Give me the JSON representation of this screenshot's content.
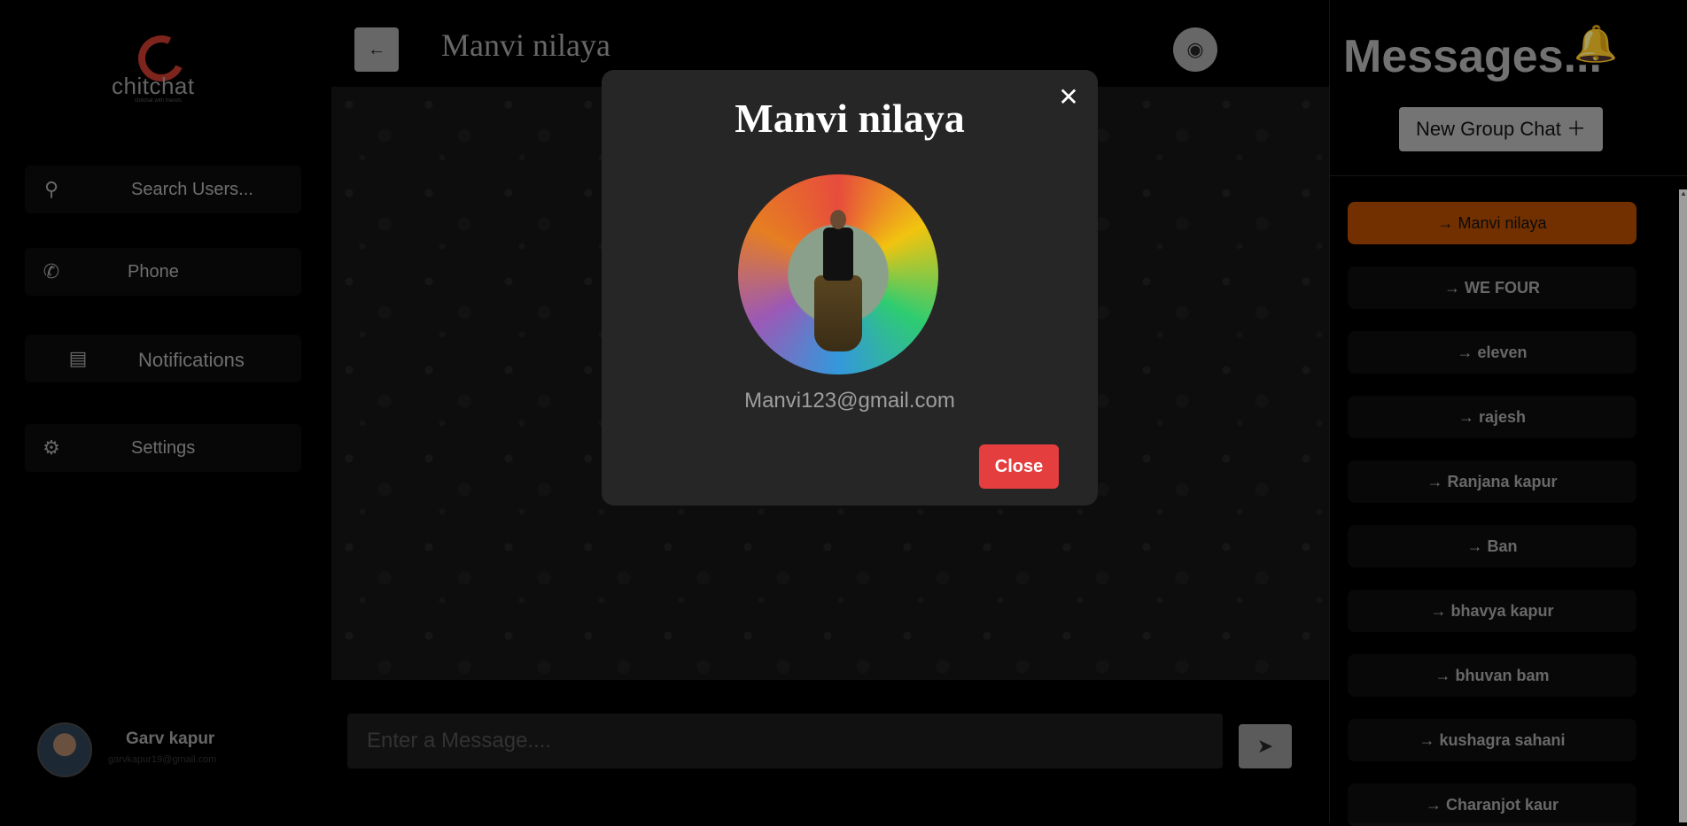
{
  "sidebar": {
    "logo_text": "chitchat",
    "logo_tagline": "chitchat with friends",
    "items": [
      {
        "label": "Search Users...",
        "icon": "search-icon"
      },
      {
        "label": "Phone",
        "icon": "phone-icon"
      },
      {
        "label": "Notifications",
        "icon": "book-icon"
      },
      {
        "label": "Settings",
        "icon": "gear-icon"
      }
    ],
    "user": {
      "name": "Garv kapur",
      "email": "garvkapur19@gmail.com"
    }
  },
  "chat": {
    "title": "Manvi nilaya",
    "message_placeholder": "Enter a Message...."
  },
  "messages_panel": {
    "heading": "Messages...",
    "new_group_label": "New Group Chat",
    "chats": [
      "→ Manvi nilaya",
      "→ WE FOUR",
      "→ eleven",
      "→ rajesh",
      "→ Ranjana kapur",
      "→ Ban",
      "→ bhavya kapur",
      "→ bhuvan bam",
      "→ kushagra sahani",
      "→ Charanjot kaur"
    ],
    "active_index": 0
  },
  "modal": {
    "title": "Manvi nilaya",
    "email": "Manvi123@gmail.com",
    "close_label": "Close"
  },
  "colors": {
    "accent_active_chat": "#b04a00",
    "close_button": "#e53e3e",
    "bell": "#c8c800",
    "logo": "#c0392b"
  }
}
